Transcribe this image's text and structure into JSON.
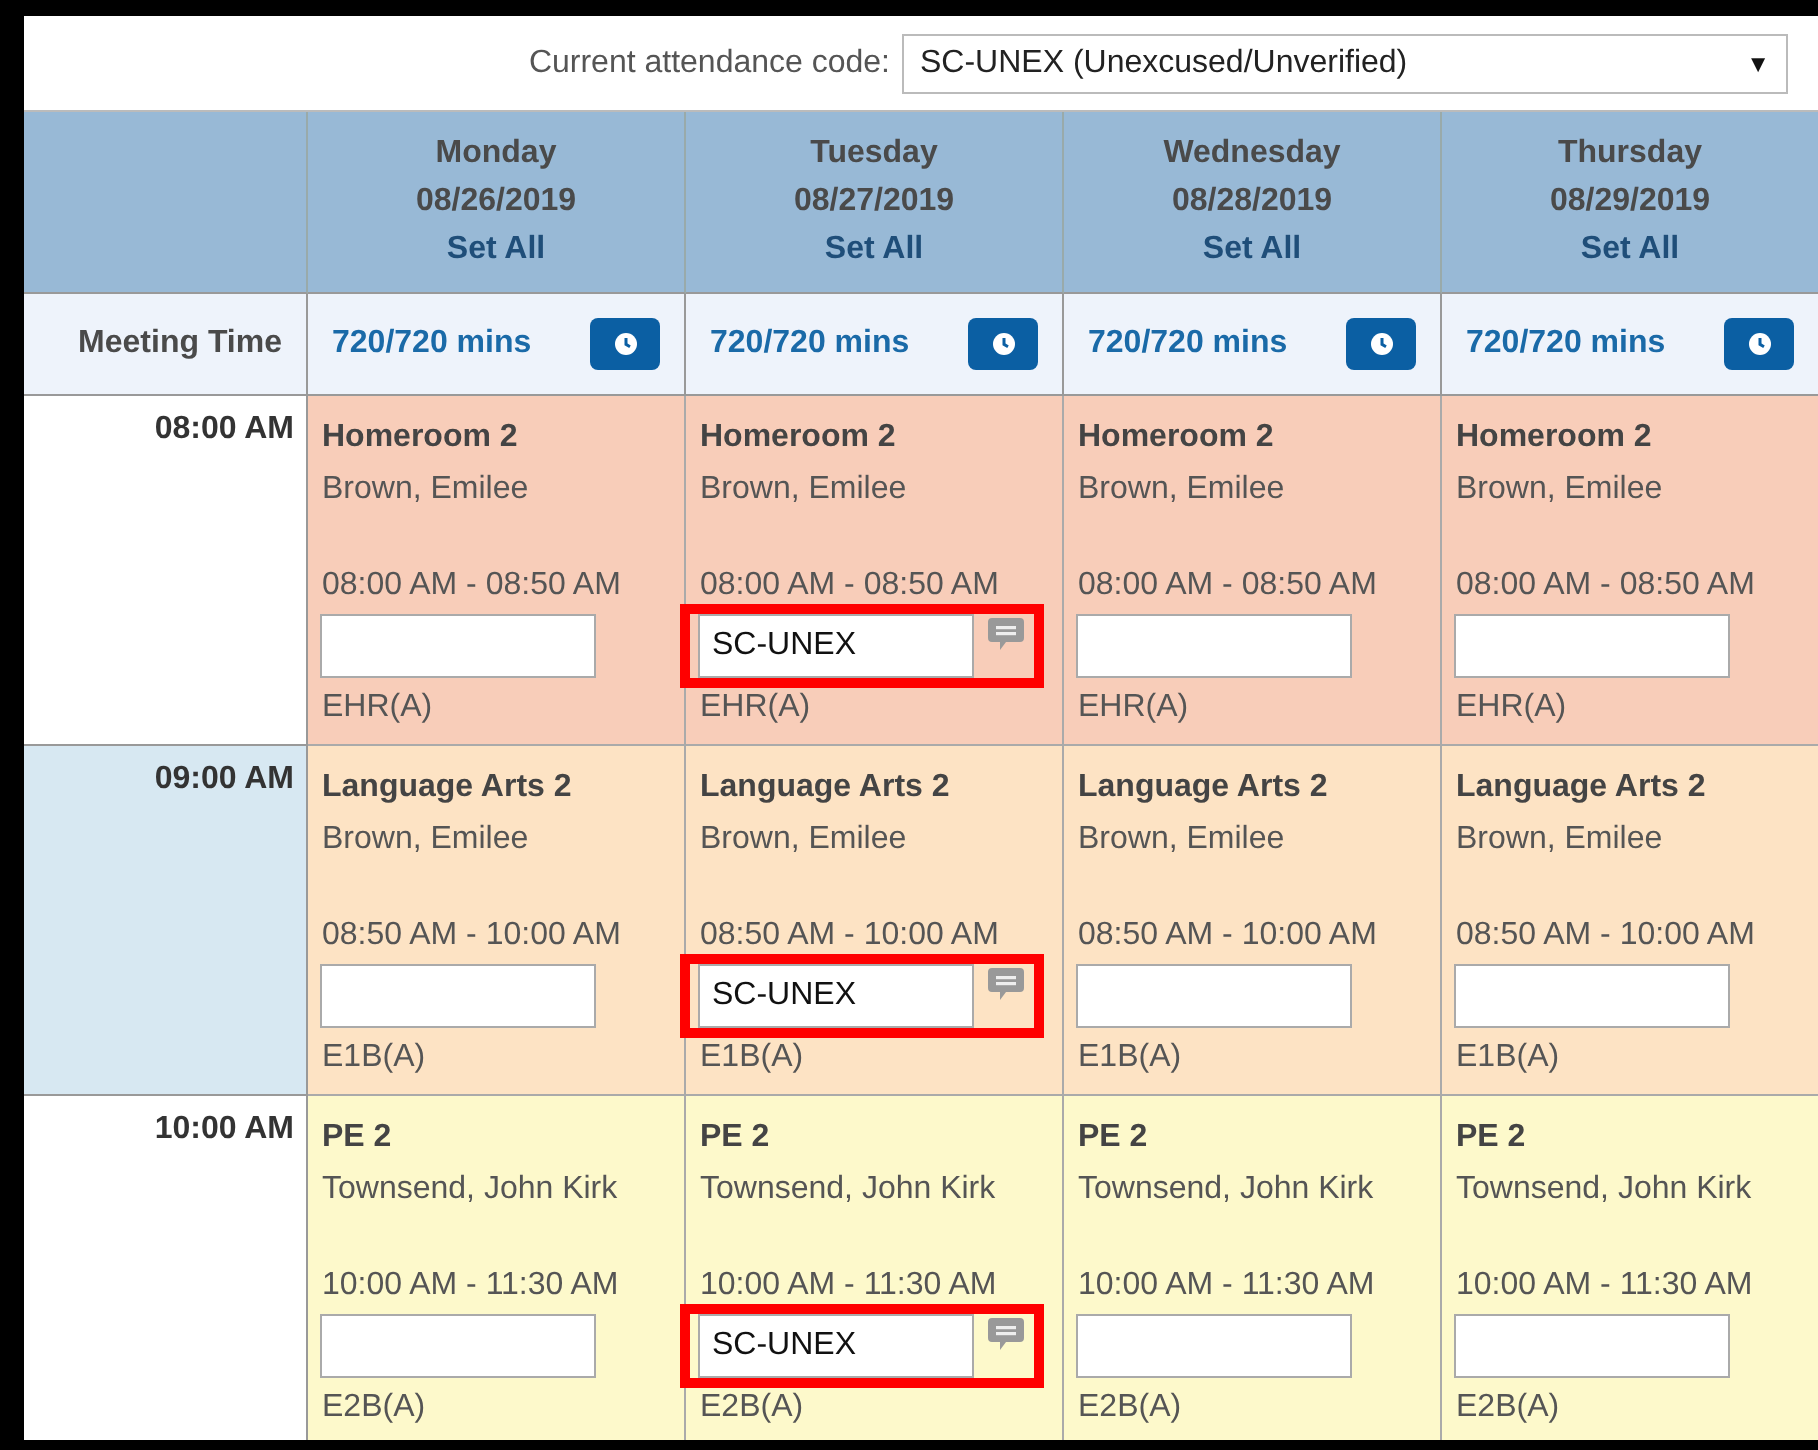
{
  "code_selector": {
    "label": "Current attendance code:",
    "value": "SC-UNEX (Unexcused/Unverified)",
    "caret": "▼"
  },
  "meeting_label": "Meeting Time",
  "days": [
    {
      "name": "Monday",
      "date": "08/26/2019",
      "set_all": "Set All",
      "meeting": "720/720 mins"
    },
    {
      "name": "Tuesday",
      "date": "08/27/2019",
      "set_all": "Set All",
      "meeting": "720/720 mins"
    },
    {
      "name": "Wednesday",
      "date": "08/28/2019",
      "set_all": "Set All",
      "meeting": "720/720 mins"
    },
    {
      "name": "Thursday",
      "date": "08/29/2019",
      "set_all": "Set All",
      "meeting": "720/720 mins"
    }
  ],
  "periods": [
    {
      "time": "08:00 AM",
      "shaded": false,
      "color": "#f8cdb9",
      "cells": [
        {
          "title": "Homeroom 2",
          "teacher": "Brown, Emilee",
          "time": "08:00 AM - 08:50 AM",
          "highlighted": false,
          "comment": false,
          "code": "EHR(A)"
        },
        {
          "title": "Homeroom 2",
          "teacher": "Brown, Emilee",
          "time": "08:00 AM - 08:50 AM",
          "value": "SC-UNEX",
          "highlighted": true,
          "comment": true,
          "code": "EHR(A)"
        },
        {
          "title": "Homeroom 2",
          "teacher": "Brown, Emilee",
          "time": "08:00 AM - 08:50 AM",
          "highlighted": false,
          "comment": false,
          "code": "EHR(A)"
        },
        {
          "title": "Homeroom 2",
          "teacher": "Brown, Emilee",
          "time": "08:00 AM - 08:50 AM",
          "highlighted": false,
          "comment": false,
          "code": "EHR(A)"
        }
      ]
    },
    {
      "time": "09:00 AM",
      "shaded": true,
      "color": "#fde3c4",
      "cells": [
        {
          "title": "Language Arts 2",
          "teacher": "Brown, Emilee",
          "time": "08:50 AM - 10:00 AM",
          "highlighted": false,
          "comment": false,
          "code": "E1B(A)"
        },
        {
          "title": "Language Arts 2",
          "teacher": "Brown, Emilee",
          "time": "08:50 AM - 10:00 AM",
          "value": "SC-UNEX",
          "highlighted": true,
          "comment": true,
          "code": "E1B(A)"
        },
        {
          "title": "Language Arts 2",
          "teacher": "Brown, Emilee",
          "time": "08:50 AM - 10:00 AM",
          "highlighted": false,
          "comment": false,
          "code": "E1B(A)"
        },
        {
          "title": "Language Arts 2",
          "teacher": "Brown, Emilee",
          "time": "08:50 AM - 10:00 AM",
          "highlighted": false,
          "comment": false,
          "code": "E1B(A)"
        }
      ]
    },
    {
      "time": "10:00 AM",
      "shaded": false,
      "color": "#fdf9cb",
      "cells": [
        {
          "title": "PE 2",
          "teacher": "Townsend, John Kirk",
          "time": "10:00 AM - 11:30 AM",
          "highlighted": false,
          "comment": false,
          "code": "E2B(A)"
        },
        {
          "title": "PE 2",
          "teacher": "Townsend, John Kirk",
          "time": "10:00 AM - 11:30 AM",
          "value": "SC-UNEX",
          "highlighted": true,
          "comment": true,
          "code": "E2B(A)"
        },
        {
          "title": "PE 2",
          "teacher": "Townsend, John Kirk",
          "time": "10:00 AM - 11:30 AM",
          "highlighted": false,
          "comment": false,
          "code": "E2B(A)"
        },
        {
          "title": "PE 2",
          "teacher": "Townsend, John Kirk",
          "time": "10:00 AM - 11:30 AM",
          "highlighted": false,
          "comment": false,
          "code": "E2B(A)"
        }
      ]
    }
  ]
}
